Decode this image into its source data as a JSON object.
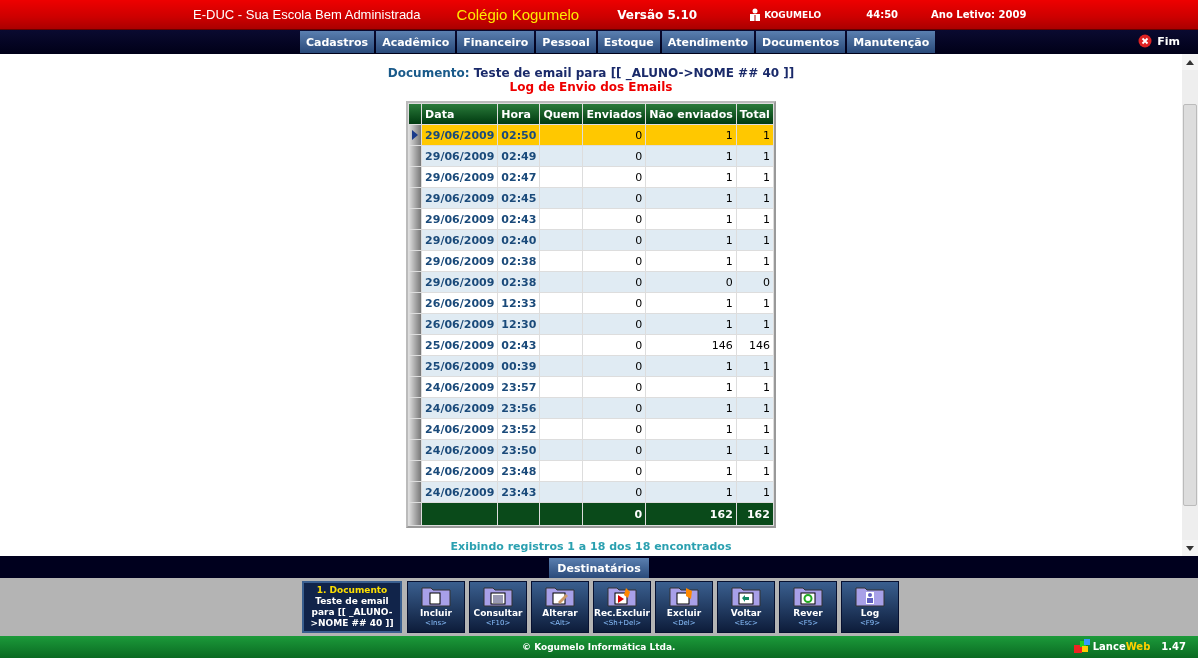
{
  "header": {
    "app_name": "E-DUC - Sua Escola Bem Administrada",
    "school": "Colégio Kogumelo",
    "version": "Versão 5.10",
    "user": "KOGUMELO",
    "timer": "44:50",
    "school_year": "Ano Letivo: 2009"
  },
  "menu": [
    "Cadastros",
    "Acadêmico",
    "Financeiro",
    "Pessoal",
    "Estoque",
    "Atendimento",
    "Documentos",
    "Manutenção"
  ],
  "exit_label": "Fim",
  "document": {
    "label": "Documento:",
    "name": "Teste de email para [[ _ALUNO->NOME ## 40 ]]"
  },
  "log_title": "Log de Envio dos Emails",
  "table": {
    "columns": [
      "Data",
      "Hora",
      "Quem",
      "Enviados",
      "Não enviados",
      "Total"
    ],
    "rows": [
      {
        "date": "29/06/2009",
        "time": "02:50",
        "sent": "0",
        "not_sent": "1",
        "total": "1",
        "selected": true
      },
      {
        "date": "29/06/2009",
        "time": "02:49",
        "sent": "0",
        "not_sent": "1",
        "total": "1",
        "selected": false
      },
      {
        "date": "29/06/2009",
        "time": "02:47",
        "sent": "0",
        "not_sent": "1",
        "total": "1",
        "selected": false
      },
      {
        "date": "29/06/2009",
        "time": "02:45",
        "sent": "0",
        "not_sent": "1",
        "total": "1",
        "selected": false
      },
      {
        "date": "29/06/2009",
        "time": "02:43",
        "sent": "0",
        "not_sent": "1",
        "total": "1",
        "selected": false
      },
      {
        "date": "29/06/2009",
        "time": "02:40",
        "sent": "0",
        "not_sent": "1",
        "total": "1",
        "selected": false
      },
      {
        "date": "29/06/2009",
        "time": "02:38",
        "sent": "0",
        "not_sent": "1",
        "total": "1",
        "selected": false
      },
      {
        "date": "29/06/2009",
        "time": "02:38",
        "sent": "0",
        "not_sent": "0",
        "total": "0",
        "selected": false
      },
      {
        "date": "26/06/2009",
        "time": "12:33",
        "sent": "0",
        "not_sent": "1",
        "total": "1",
        "selected": false
      },
      {
        "date": "26/06/2009",
        "time": "12:30",
        "sent": "0",
        "not_sent": "1",
        "total": "1",
        "selected": false
      },
      {
        "date": "25/06/2009",
        "time": "02:43",
        "sent": "0",
        "not_sent": "146",
        "total": "146",
        "selected": false
      },
      {
        "date": "25/06/2009",
        "time": "00:39",
        "sent": "0",
        "not_sent": "1",
        "total": "1",
        "selected": false
      },
      {
        "date": "24/06/2009",
        "time": "23:57",
        "sent": "0",
        "not_sent": "1",
        "total": "1",
        "selected": false
      },
      {
        "date": "24/06/2009",
        "time": "23:56",
        "sent": "0",
        "not_sent": "1",
        "total": "1",
        "selected": false
      },
      {
        "date": "24/06/2009",
        "time": "23:52",
        "sent": "0",
        "not_sent": "1",
        "total": "1",
        "selected": false
      },
      {
        "date": "24/06/2009",
        "time": "23:50",
        "sent": "0",
        "not_sent": "1",
        "total": "1",
        "selected": false
      },
      {
        "date": "24/06/2009",
        "time": "23:48",
        "sent": "0",
        "not_sent": "1",
        "total": "1",
        "selected": false
      },
      {
        "date": "24/06/2009",
        "time": "23:43",
        "sent": "0",
        "not_sent": "1",
        "total": "1",
        "selected": false
      }
    ],
    "totals": {
      "sent": "0",
      "not_sent": "162",
      "total": "162"
    }
  },
  "records_info": "Exibindo registros 1 a 18 dos 18 encontrados",
  "tab_button": "Destinatários",
  "context": {
    "title": "1. Documento",
    "text": "Teste de email para [[ _ALUNO->NOME ## 40 ]]"
  },
  "toolbar": [
    {
      "label": "Incluir",
      "shortcut": "<Ins>",
      "kind": "add"
    },
    {
      "label": "Consultar",
      "shortcut": "<F10>",
      "kind": "view"
    },
    {
      "label": "Alterar",
      "shortcut": "<Alt>",
      "kind": "edit"
    },
    {
      "label": "Rec.Excluir",
      "shortcut": "<Sh+Del>",
      "kind": "burn"
    },
    {
      "label": "Excluir",
      "shortcut": "<Del>",
      "kind": "delete"
    },
    {
      "label": "Voltar",
      "shortcut": "<Esc>",
      "kind": "back"
    },
    {
      "label": "Rever",
      "shortcut": "<F5>",
      "kind": "refresh"
    },
    {
      "label": "Log",
      "shortcut": "<F9>",
      "kind": "log"
    }
  ],
  "footer": {
    "copyright": "© Kogumelo Informática Ltda.",
    "brand_first": "Lance",
    "brand_second": "Web",
    "brand_version": "1.47"
  }
}
